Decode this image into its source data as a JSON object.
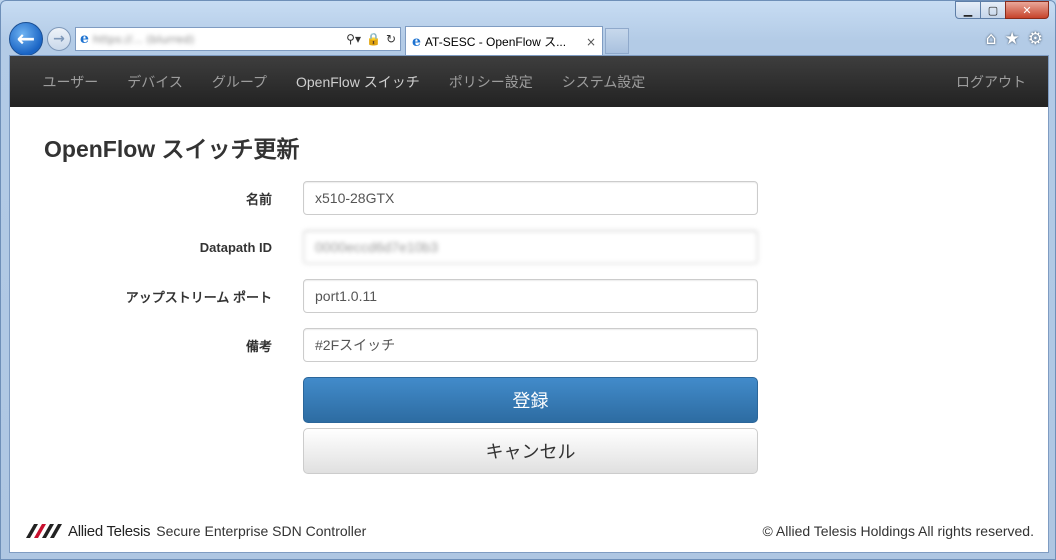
{
  "browser": {
    "url": "https://... (blurred)",
    "tab_title": "AT-SESC - OpenFlow ス...",
    "tab_close": "×",
    "addr_icons": [
      "⚲ ▾",
      "🔒",
      "↻"
    ]
  },
  "navbar": {
    "items": [
      "ユーザー",
      "デバイス",
      "グループ",
      "OpenFlow スイッチ",
      "ポリシー設定",
      "システム設定"
    ],
    "active": "OpenFlow スイッチ",
    "logout": "ログアウト"
  },
  "page": {
    "title": "OpenFlow スイッチ更新"
  },
  "form": {
    "name_label": "名前",
    "name_value": "x510-28GTX",
    "datapath_label": "Datapath ID",
    "datapath_value": "0000eccd6d7e10b3",
    "upstream_label": "アップストリーム ポート",
    "upstream_value": "port1.0.11",
    "note_label": "備考",
    "note_value": "#2Fスイッチ",
    "submit_label": "登録",
    "cancel_label": "キャンセル"
  },
  "footer": {
    "brand": "Allied Telesis",
    "product": "Secure Enterprise SDN Controller",
    "copyright": "© Allied Telesis Holdings All rights reserved."
  },
  "colors": {
    "navbar_bg": "#222222",
    "primary": "#337ab7"
  }
}
